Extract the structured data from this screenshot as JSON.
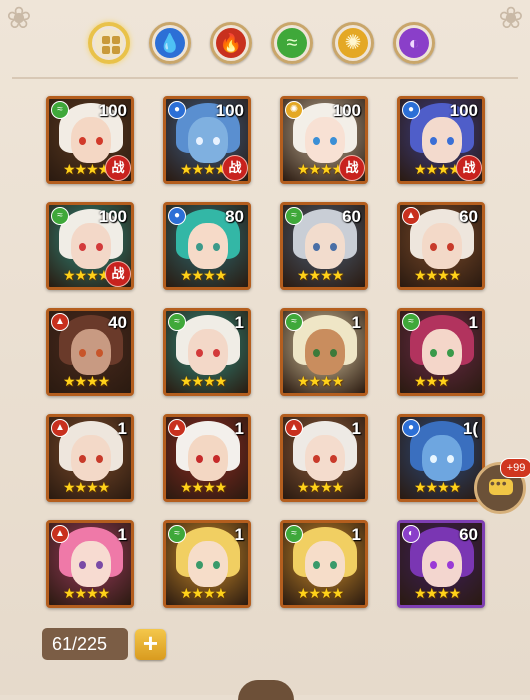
{
  "filters": [
    {
      "name": "all",
      "icon": "grid-icon",
      "color": "#e9c24a",
      "selected": true
    },
    {
      "name": "water",
      "icon": "water-drop-icon",
      "color": "#2c6fd6",
      "selected": false
    },
    {
      "name": "fire",
      "icon": "fire-icon",
      "color": "#c8301e",
      "selected": false
    },
    {
      "name": "wind",
      "icon": "wind-icon",
      "color": "#3fa83a",
      "selected": false
    },
    {
      "name": "light",
      "icon": "sun-icon",
      "color": "#e4a825",
      "selected": false
    },
    {
      "name": "dark",
      "icon": "moon-icon",
      "color": "#8a3fc9",
      "selected": false
    }
  ],
  "heroes": [
    {
      "element": "wind",
      "level": "100",
      "stars": "★★★★",
      "war_badge": "战",
      "hair": "#f2ece4",
      "skin": "#f4d7c4",
      "eye": "#d23a2a",
      "bg": "#5c3a20"
    },
    {
      "element": "water",
      "level": "100",
      "stars": "★★★★",
      "war_badge": "战",
      "hair": "#5a8fd0",
      "skin": "#7fb0e0",
      "eye": "#e8f2ff",
      "bg": "#3b5c84"
    },
    {
      "element": "light",
      "level": "100",
      "stars": "★★★★",
      "war_badge": "战",
      "hair": "#f3efe8",
      "skin": "#f8e1d4",
      "eye": "#3a8fd6",
      "bg": "#bfae95"
    },
    {
      "element": "water",
      "level": "100",
      "stars": "★★★★",
      "war_badge": "战",
      "hair": "#4f5ec9",
      "skin": "#f3dacd",
      "eye": "#3a6fd6",
      "bg": "#3c3f8a"
    },
    {
      "element": "wind",
      "level": "100",
      "stars": "★★★★",
      "war_badge": "战",
      "hair": "#f0ede6",
      "skin": "#f3d8c8",
      "eye": "#d33a3a",
      "bg": "#2f8a7c"
    },
    {
      "element": "water",
      "level": "80",
      "stars": "★★★★",
      "war_badge": "",
      "hair": "#33b7a6",
      "skin": "#f6dac8",
      "eye": "#3c9a8a",
      "bg": "#2c6b72"
    },
    {
      "element": "wind",
      "level": "60",
      "stars": "★★★★",
      "war_badge": "",
      "hair": "#c9ced6",
      "skin": "#f2dccd",
      "eye": "#4a6fa6",
      "bg": "#4a5c72"
    },
    {
      "element": "fire",
      "level": "60",
      "stars": "★★★★",
      "war_badge": "",
      "hair": "#eee6dd",
      "skin": "#f3d9c8",
      "eye": "#c83a2a",
      "bg": "#7a4a2a"
    },
    {
      "element": "fire",
      "level": "40",
      "stars": "★★★★",
      "war_badge": "",
      "hair": "#6a3a2a",
      "skin": "#c89a82",
      "eye": "#c8552a",
      "bg": "#4a2a1e"
    },
    {
      "element": "wind",
      "level": "1",
      "stars": "★★★★",
      "war_badge": "",
      "hair": "#f0ede6",
      "skin": "#f3d8c8",
      "eye": "#d33a3a",
      "bg": "#2f8a7c"
    },
    {
      "element": "wind",
      "level": "1",
      "stars": "★★★★",
      "war_badge": "",
      "hair": "#efe6c6",
      "skin": "#c98d5e",
      "eye": "#3d7a3a",
      "bg": "#d9c7a0"
    },
    {
      "element": "wind",
      "level": "1",
      "stars": "★★★",
      "war_badge": "",
      "hair": "#b2335e",
      "skin": "#f4d6c9",
      "eye": "#3a9a4a",
      "bg": "#6a2a48"
    },
    {
      "element": "fire",
      "level": "1",
      "stars": "★★★★",
      "war_badge": "",
      "hair": "#eee6dd",
      "skin": "#f3d9c8",
      "eye": "#c83a2a",
      "bg": "#7a4a2a"
    },
    {
      "element": "fire",
      "level": "1",
      "stars": "★★★★",
      "war_badge": "",
      "hair": "#f3f0ec",
      "skin": "#f3d7c3",
      "eye": "#c62a2a",
      "bg": "#8a2a22"
    },
    {
      "element": "fire",
      "level": "1",
      "stars": "★★★★",
      "war_badge": "",
      "hair": "#eeeae5",
      "skin": "#f4dccd",
      "eye": "#c93a2a",
      "bg": "#8a5a3a"
    },
    {
      "element": "water",
      "level": "1(",
      "stars": "★★★★",
      "war_badge": "",
      "hair": "#3a6fbf",
      "skin": "#6ea6e0",
      "eye": "#e8f6ff",
      "bg": "#2a4a7c"
    },
    {
      "element": "fire",
      "level": "1",
      "stars": "★★★★",
      "war_badge": "",
      "hair": "#ef79a8",
      "skin": "#f7dbd1",
      "eye": "#7a4aa6",
      "bg": "#9a3a5c"
    },
    {
      "element": "wind",
      "level": "1",
      "stars": "★★★★",
      "war_badge": "",
      "hair": "#f1cf62",
      "skin": "#f6ddc9",
      "eye": "#3a9a6a",
      "bg": "#c98a2a"
    },
    {
      "element": "wind",
      "level": "1",
      "stars": "★★★★",
      "war_badge": "",
      "hair": "#f1cf62",
      "skin": "#f6ddc9",
      "eye": "#3a9a6a",
      "bg": "#c98a2a"
    },
    {
      "element": "dark",
      "level": "60",
      "stars": "★★★★",
      "war_badge": "",
      "hair": "#7a36b3",
      "skin": "#f3d6cf",
      "eye": "#9a3ad6",
      "bg": "#3e1f5c",
      "purple": true
    }
  ],
  "element_colors": {
    "wind": "#3fa83a",
    "water": "#2c6fd6",
    "fire": "#c8301e",
    "light": "#e4a825",
    "dark": "#8a3fc9"
  },
  "element_icons": {
    "wind": "≈",
    "water": "●",
    "fire": "▲",
    "light": "✺",
    "dark": "◐"
  },
  "footer": {
    "hero_count": "61/225",
    "plus_label": "+"
  },
  "chat": {
    "badge": "+99",
    "icon": "chat-bubble-icon"
  }
}
